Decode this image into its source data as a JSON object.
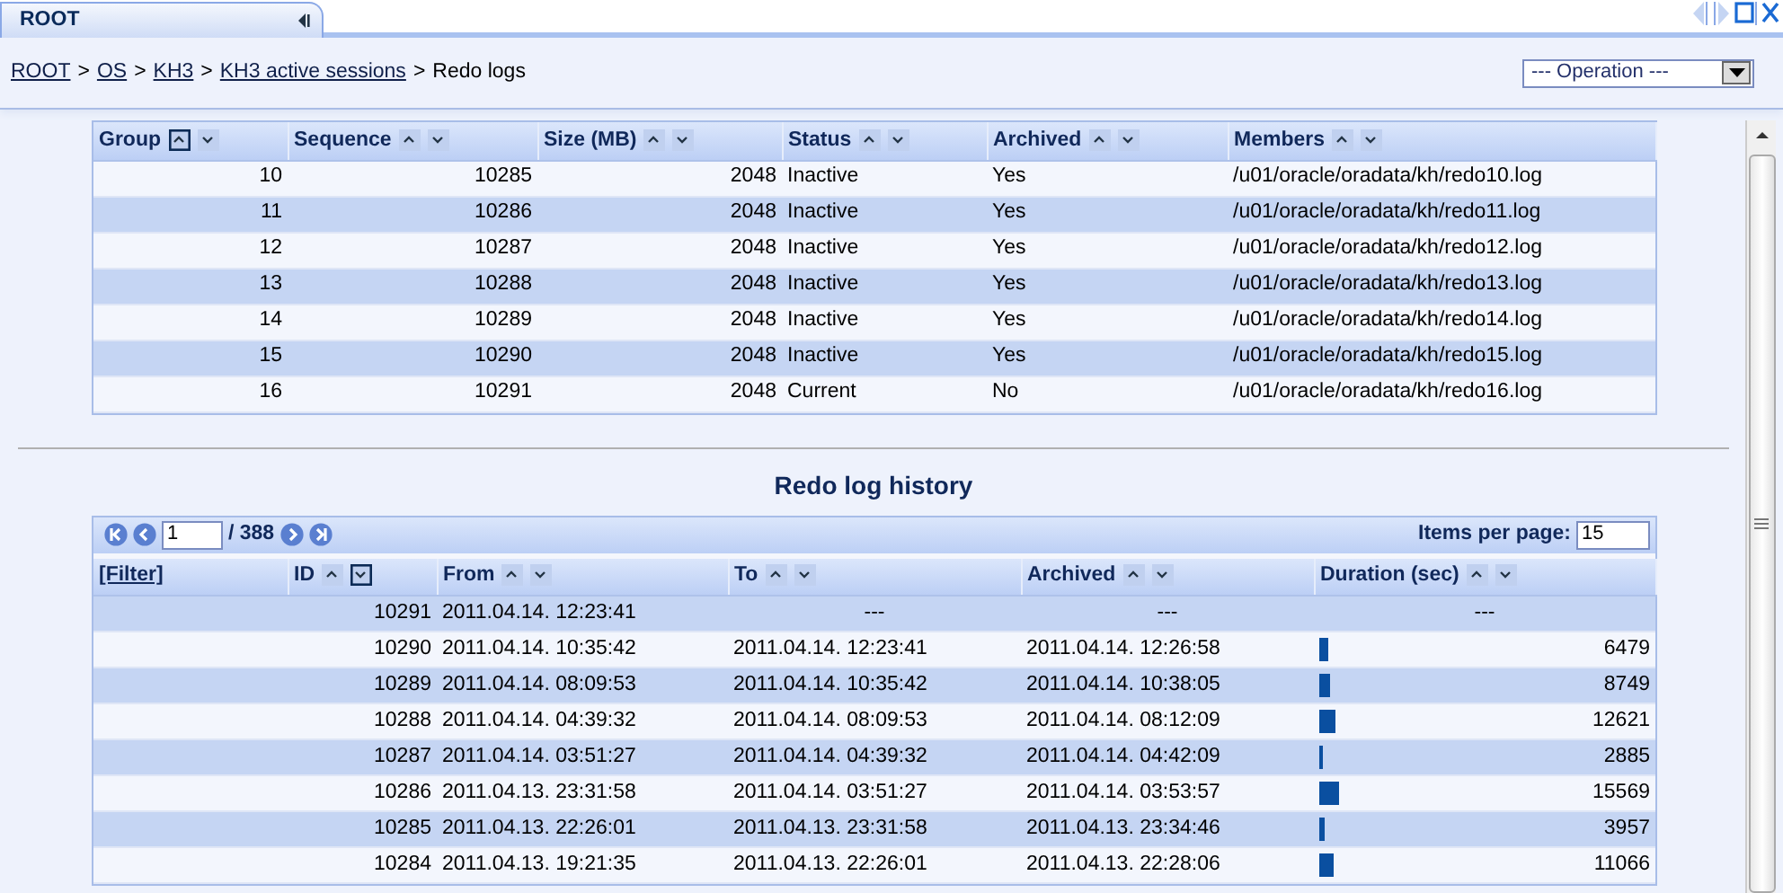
{
  "tab": {
    "label": "ROOT"
  },
  "breadcrumb": [
    {
      "kind": "link",
      "label": "ROOT"
    },
    {
      "kind": "separator",
      "label": ">"
    },
    {
      "kind": "link",
      "label": "OS"
    },
    {
      "kind": "separator",
      "label": ">"
    },
    {
      "kind": "link",
      "label": "KH3"
    },
    {
      "kind": "separator",
      "label": ">"
    },
    {
      "kind": "link",
      "label": "KH3 active sessions"
    },
    {
      "kind": "separator",
      "label": ">"
    },
    {
      "kind": "current",
      "label": "Redo logs"
    }
  ],
  "operation_select": {
    "value": "--- Operation ---"
  },
  "redo_logs": {
    "columns": [
      {
        "label": "Group",
        "sort_asc": true,
        "sort_desc": false
      },
      {
        "label": "Sequence",
        "sort_asc": false,
        "sort_desc": false
      },
      {
        "label": "Size (MB)",
        "sort_asc": false,
        "sort_desc": false
      },
      {
        "label": "Status",
        "sort_asc": false,
        "sort_desc": false
      },
      {
        "label": "Archived",
        "sort_asc": false,
        "sort_desc": false
      },
      {
        "label": "Members",
        "sort_asc": false,
        "sort_desc": false
      }
    ],
    "rows": [
      [
        "10",
        "10285",
        "2048",
        "Inactive",
        "Yes",
        "/u01/oracle/oradata/kh/redo10.log"
      ],
      [
        "11",
        "10286",
        "2048",
        "Inactive",
        "Yes",
        "/u01/oracle/oradata/kh/redo11.log"
      ],
      [
        "12",
        "10287",
        "2048",
        "Inactive",
        "Yes",
        "/u01/oracle/oradata/kh/redo12.log"
      ],
      [
        "13",
        "10288",
        "2048",
        "Inactive",
        "Yes",
        "/u01/oracle/oradata/kh/redo13.log"
      ],
      [
        "14",
        "10289",
        "2048",
        "Inactive",
        "Yes",
        "/u01/oracle/oradata/kh/redo14.log"
      ],
      [
        "15",
        "10290",
        "2048",
        "Inactive",
        "Yes",
        "/u01/oracle/oradata/kh/redo15.log"
      ],
      [
        "16",
        "10291",
        "2048",
        "Current",
        "No",
        "/u01/oracle/oradata/kh/redo16.log"
      ]
    ]
  },
  "history": {
    "title": "Redo log history",
    "pager": {
      "page": "1",
      "total": "/ 388",
      "items_per_page_label": "Items per page:",
      "items_per_page": "15"
    },
    "filter_link": "[Filter]",
    "columns": [
      {
        "label": "ID",
        "sort_asc": false,
        "sort_desc": true
      },
      {
        "label": "From",
        "sort_asc": false,
        "sort_desc": false
      },
      {
        "label": "To",
        "sort_asc": false,
        "sort_desc": false
      },
      {
        "label": "Archived",
        "sort_asc": false,
        "sort_desc": false
      },
      {
        "label": "Duration (sec)",
        "sort_asc": false,
        "sort_desc": false
      }
    ],
    "rows": [
      {
        "id": "10291",
        "from": "2011.04.14. 12:23:41",
        "to": "---",
        "archived": "---",
        "duration": "---"
      },
      {
        "id": "10290",
        "from": "2011.04.14. 10:35:42",
        "to": "2011.04.14. 12:23:41",
        "archived": "2011.04.14. 12:26:58",
        "duration": "6479",
        "level": 0.03
      },
      {
        "id": "10289",
        "from": "2011.04.14. 08:09:53",
        "to": "2011.04.14. 10:35:42",
        "archived": "2011.04.14. 10:38:05",
        "duration": "8749",
        "level": 0.04
      },
      {
        "id": "10288",
        "from": "2011.04.14. 04:39:32",
        "to": "2011.04.14. 08:09:53",
        "archived": "2011.04.14. 08:12:09",
        "duration": "12621",
        "level": 0.06
      },
      {
        "id": "10287",
        "from": "2011.04.14. 03:51:27",
        "to": "2011.04.14. 04:39:32",
        "archived": "2011.04.14. 04:42:09",
        "duration": "2885",
        "level": 0.015
      },
      {
        "id": "10286",
        "from": "2011.04.13. 23:31:58",
        "to": "2011.04.14. 03:51:27",
        "archived": "2011.04.14. 03:53:57",
        "duration": "15569",
        "level": 0.07
      },
      {
        "id": "10285",
        "from": "2011.04.13. 22:26:01",
        "to": "2011.04.13. 23:31:58",
        "archived": "2011.04.13. 23:34:46",
        "duration": "3957",
        "level": 0.02
      },
      {
        "id": "10284",
        "from": "2011.04.13. 19:21:35",
        "to": "2011.04.13. 22:26:01",
        "archived": "2011.04.13. 22:28:06",
        "duration": "11066",
        "level": 0.05
      }
    ]
  }
}
